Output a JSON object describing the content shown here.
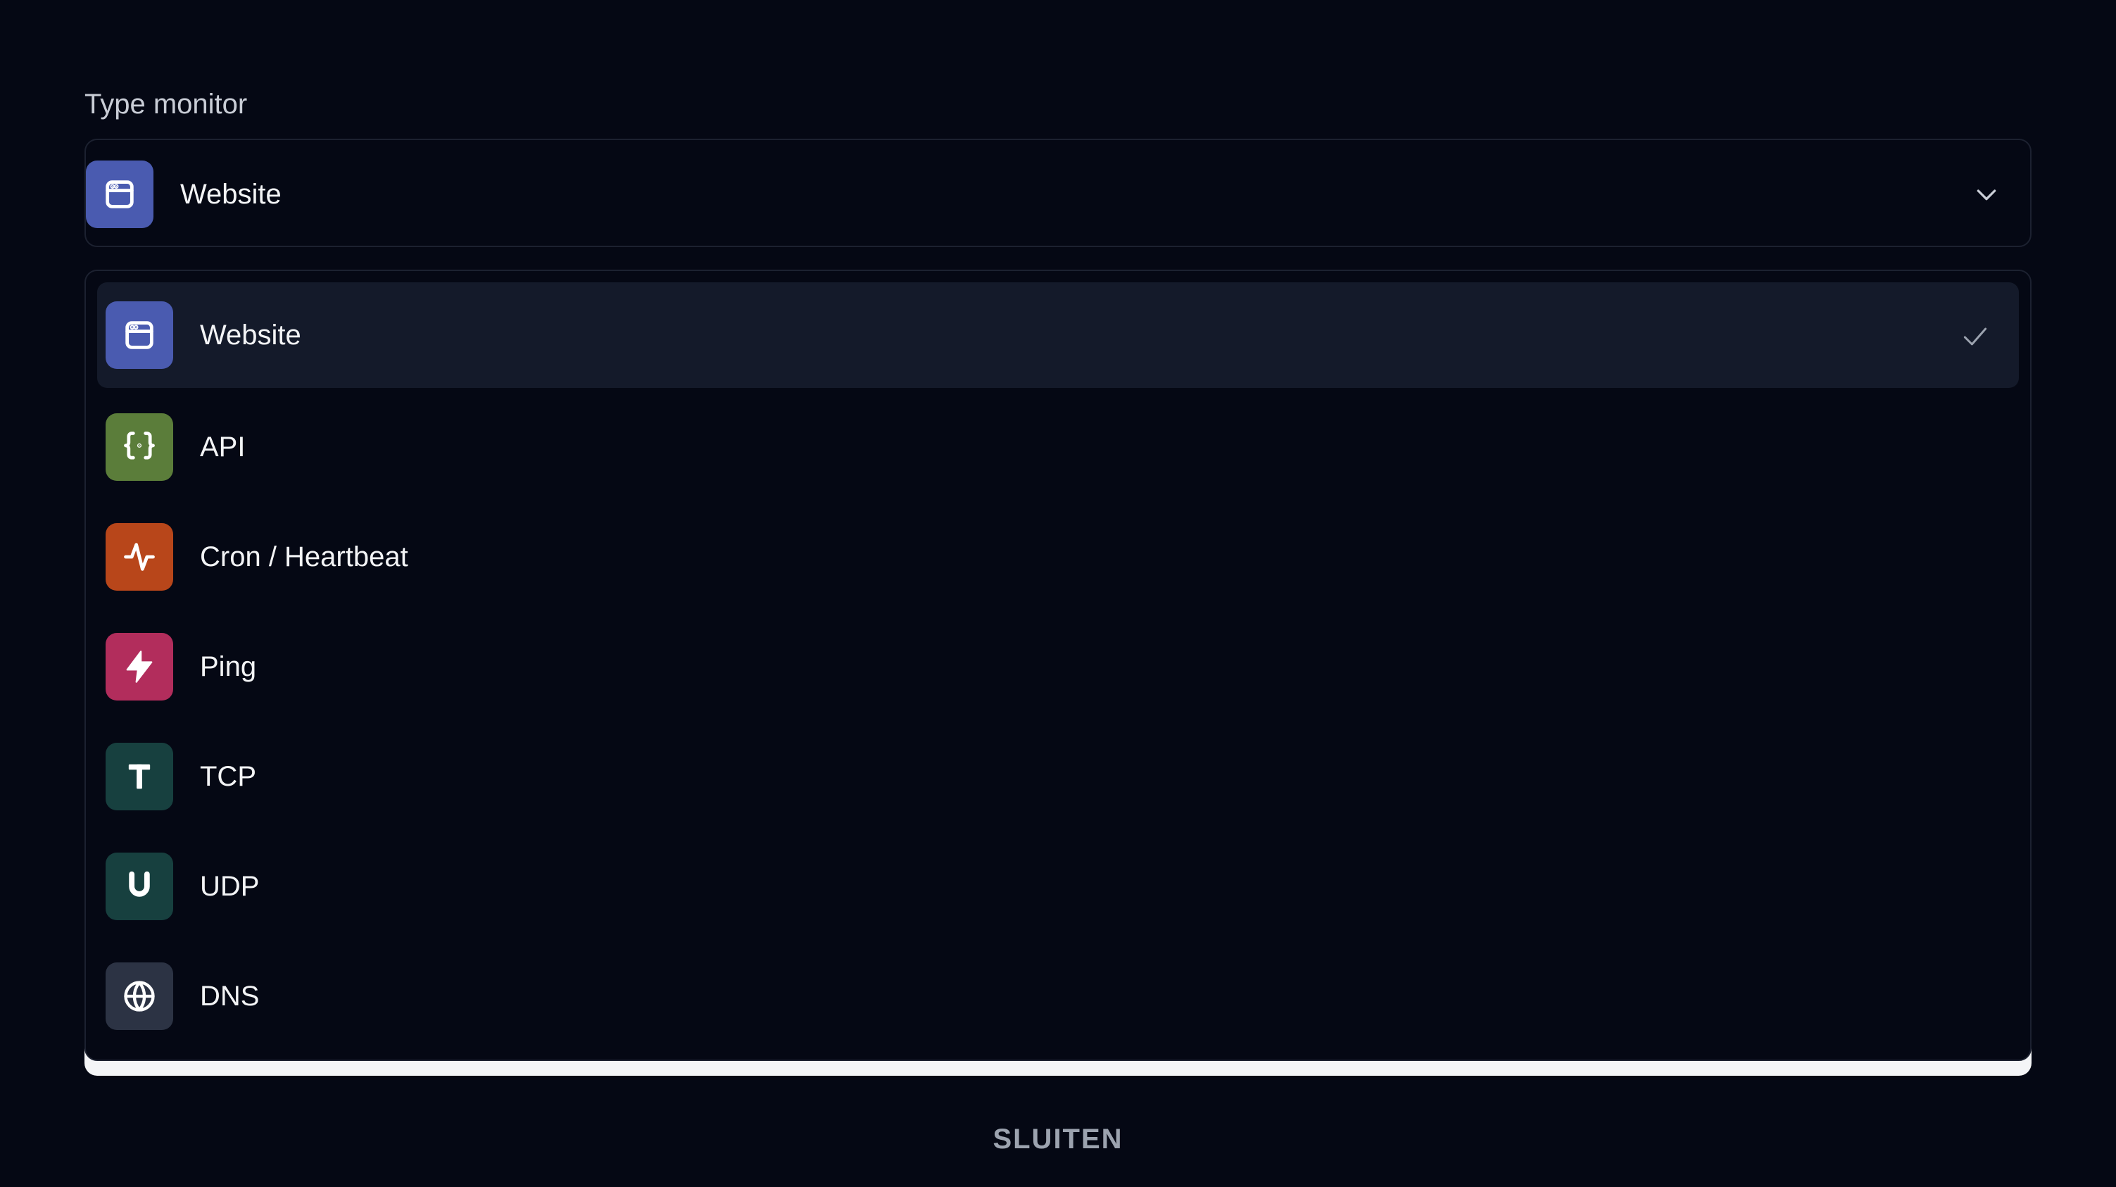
{
  "form": {
    "label": "Type monitor",
    "select": {
      "value": "Website",
      "icon": "browser-window-icon",
      "color": "#4a5bb0"
    }
  },
  "options": [
    {
      "label": "Website",
      "icon": "browser-window-icon",
      "color": "#4a5bb0",
      "selected": true
    },
    {
      "label": "API",
      "icon": "curly-braces-icon",
      "color": "#5b7d3a",
      "selected": false
    },
    {
      "label": "Cron / Heartbeat",
      "icon": "activity-pulse-icon",
      "color": "#b8461a",
      "selected": false
    },
    {
      "label": "Ping",
      "icon": "lightning-bolt-icon",
      "color": "#b22d5c",
      "selected": false
    },
    {
      "label": "TCP",
      "icon": "letter-t-icon",
      "color": "#17403f",
      "selected": false
    },
    {
      "label": "UDP",
      "icon": "letter-u-icon",
      "color": "#17403f",
      "selected": false
    },
    {
      "label": "DNS",
      "icon": "globe-icon",
      "color": "#2c3344",
      "selected": false
    }
  ],
  "close_button": "SLUITEN"
}
